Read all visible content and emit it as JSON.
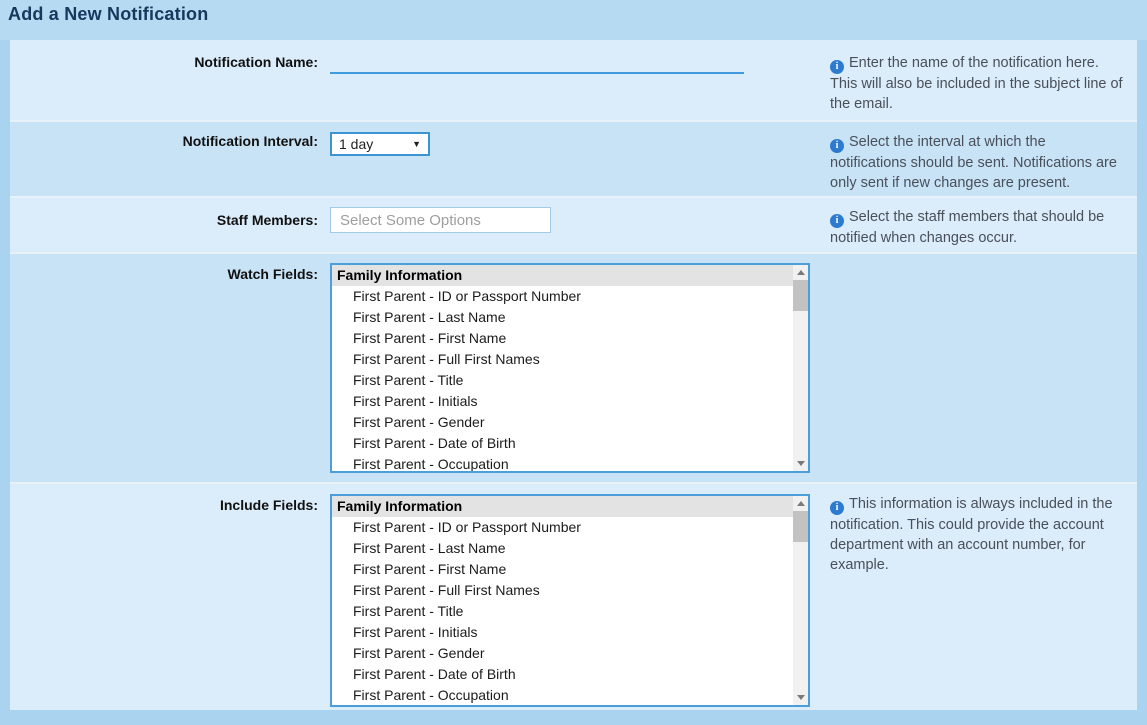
{
  "page": {
    "title": "Add a New Notification"
  },
  "icons": {
    "info_glyph": "i",
    "select_arrow_glyph": "▼"
  },
  "colors": {
    "page_background": "#a9d3ee",
    "header_background": "#b5daf2",
    "title_text": "#16385d",
    "row_light": "#dbecfa",
    "row_dark": "#c8e2f6",
    "accent_blue": "#3c95d2",
    "underline_blue": "#3f9ae0",
    "listbox_border": "#4c9eda",
    "info_icon": "#2c7bd1",
    "help_text": "#49505a",
    "group_header_bg": "#e3e3e3"
  },
  "form": {
    "notification_name": {
      "label": "Notification Name:",
      "value": "",
      "help": "Enter the name of the notification here. This will also be included in the subject line of the email."
    },
    "notification_interval": {
      "label": "Notification Interval:",
      "selected": "1 day",
      "help": "Select the interval at which the notifications should be sent. Notifications are only sent if new changes are present."
    },
    "staff_members": {
      "label": "Staff Members:",
      "value": "",
      "placeholder": "Select Some Options",
      "help": "Select the staff members that should be notified when changes occur."
    },
    "watch_fields": {
      "label": "Watch Fields:",
      "group_header": "Family Information",
      "options": [
        "First Parent - ID or Passport Number",
        "First Parent - Last Name",
        "First Parent - First Name",
        "First Parent - Full First Names",
        "First Parent - Title",
        "First Parent - Initials",
        "First Parent - Gender",
        "First Parent - Date of Birth",
        "First Parent - Occupation"
      ],
      "help": ""
    },
    "include_fields": {
      "label": "Include Fields:",
      "group_header": "Family Information",
      "options": [
        "First Parent - ID or Passport Number",
        "First Parent - Last Name",
        "First Parent - First Name",
        "First Parent - Full First Names",
        "First Parent - Title",
        "First Parent - Initials",
        "First Parent - Gender",
        "First Parent - Date of Birth",
        "First Parent - Occupation"
      ],
      "help": "This information is always included in the notification. This could provide the account department with an account number, for example."
    }
  }
}
